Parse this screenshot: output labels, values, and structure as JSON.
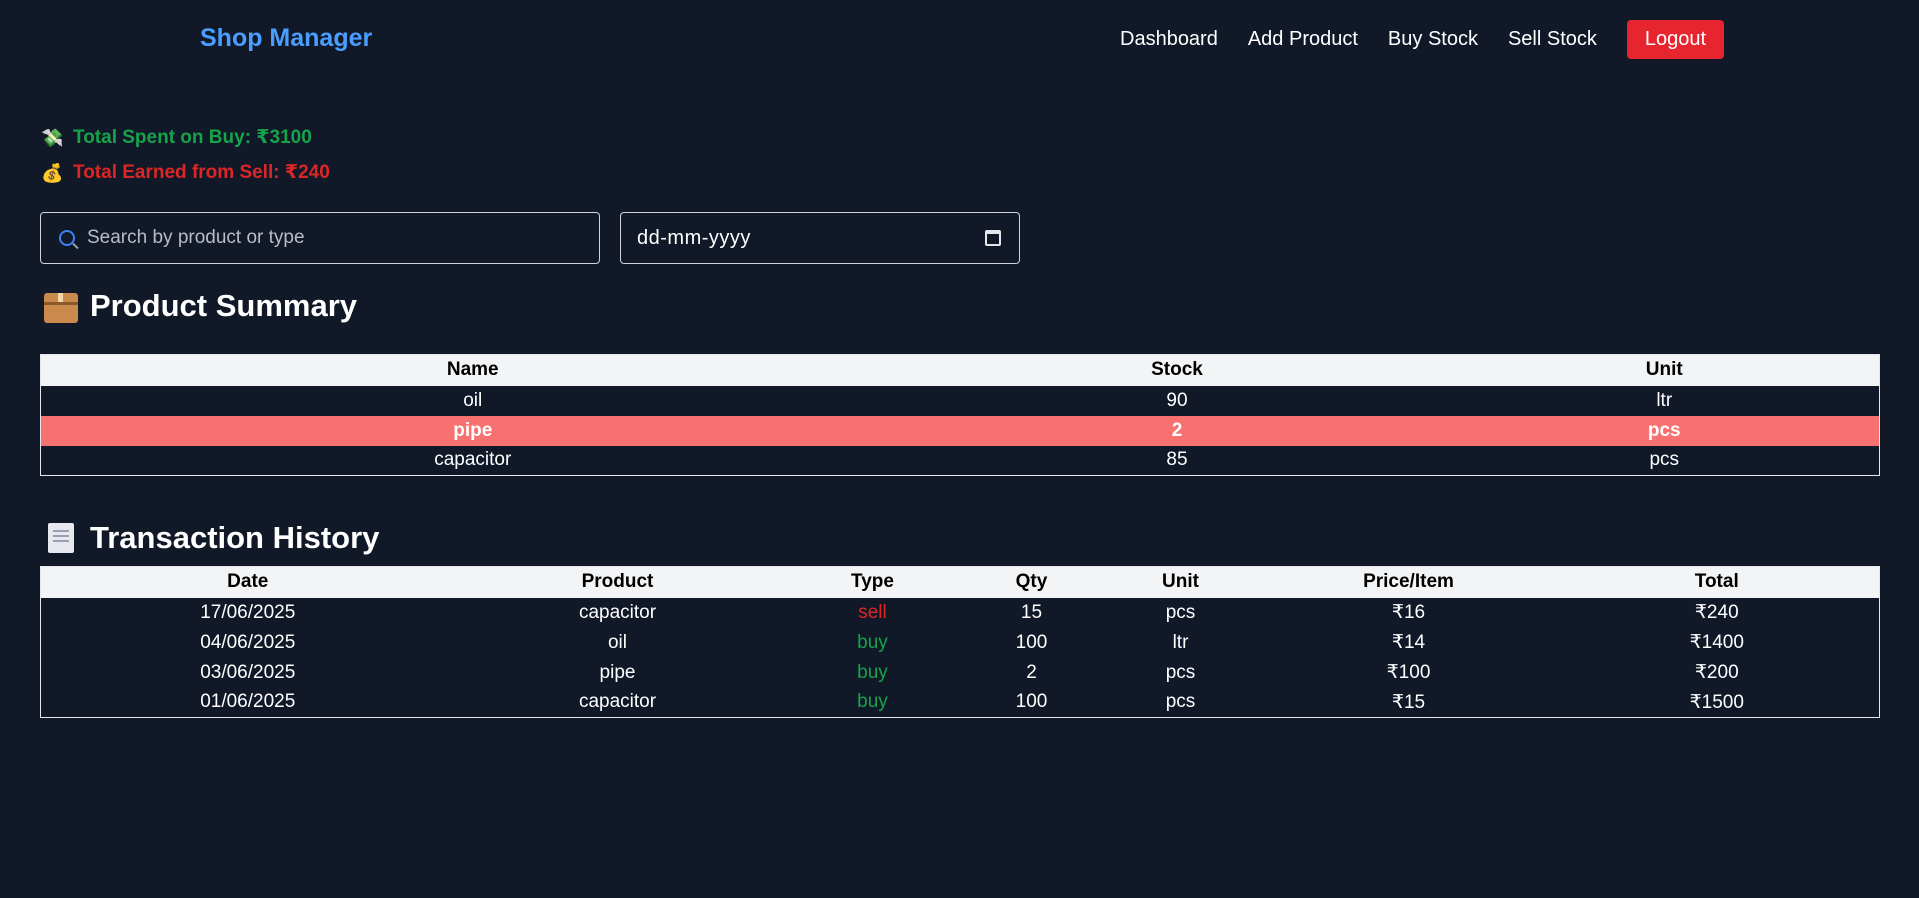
{
  "nav": {
    "brand": "Shop Manager",
    "links": [
      "Dashboard",
      "Add Product",
      "Buy Stock",
      "Sell Stock"
    ],
    "logout_label": "Logout"
  },
  "stats": {
    "buy_icon": "money-with-wings-icon",
    "buy_text": "Total Spent on Buy: ₹3100",
    "sell_icon": "money-bag-icon",
    "sell_text": "Total Earned from Sell: ₹240"
  },
  "filters": {
    "search_placeholder": "Search by product or type",
    "search_value": "",
    "date_placeholder": "dd-mm-yyyy"
  },
  "product_summary": {
    "title": "Product Summary",
    "icon": "package-icon",
    "columns": [
      "Name",
      "Stock",
      "Unit"
    ],
    "rows": [
      {
        "name": "oil",
        "stock": "90",
        "unit": "ltr",
        "low": false
      },
      {
        "name": "pipe",
        "stock": "2",
        "unit": "pcs",
        "low": true
      },
      {
        "name": "capacitor",
        "stock": "85",
        "unit": "pcs",
        "low": false
      }
    ]
  },
  "transactions": {
    "title": "Transaction History",
    "icon": "receipt-icon",
    "columns": [
      "Date",
      "Product",
      "Type",
      "Qty",
      "Unit",
      "Price/Item",
      "Total"
    ],
    "rows": [
      {
        "date": "17/06/2025",
        "product": "capacitor",
        "type": "sell",
        "qty": "15",
        "unit": "pcs",
        "price": "₹16",
        "total": "₹240"
      },
      {
        "date": "04/06/2025",
        "product": "oil",
        "type": "buy",
        "qty": "100",
        "unit": "ltr",
        "price": "₹14",
        "total": "₹1400"
      },
      {
        "date": "03/06/2025",
        "product": "pipe",
        "type": "buy",
        "qty": "2",
        "unit": "pcs",
        "price": "₹100",
        "total": "₹200"
      },
      {
        "date": "01/06/2025",
        "product": "capacitor",
        "type": "buy",
        "qty": "100",
        "unit": "pcs",
        "price": "₹15",
        "total": "₹1500"
      }
    ]
  },
  "colors": {
    "background": "#111827",
    "brand": "#4a9eff",
    "logout": "#e7252f",
    "buy": "#16a34a",
    "sell": "#dc2626",
    "low_stock_row": "#f87171"
  }
}
